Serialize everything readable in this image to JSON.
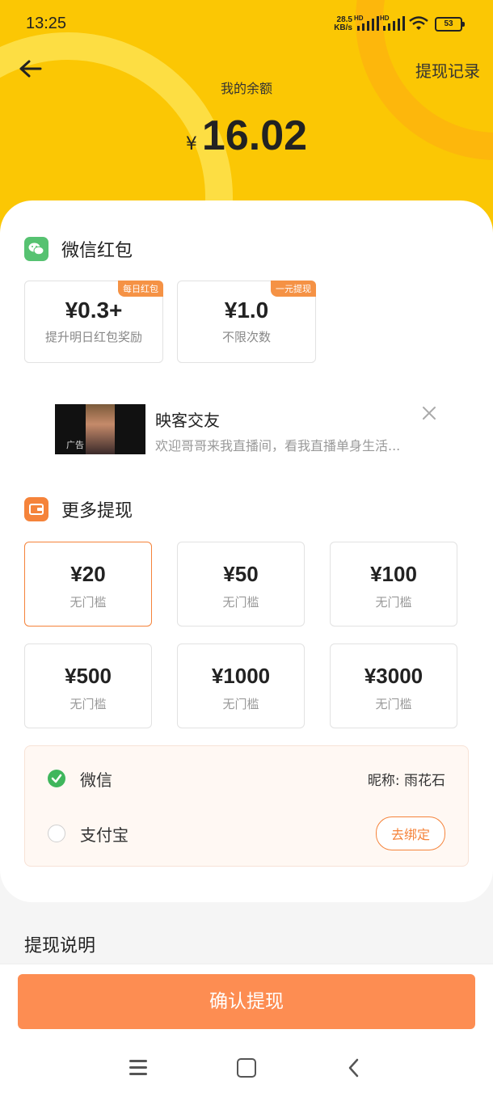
{
  "status_bar": {
    "time": "13:25",
    "net_speed_value": "28.5",
    "net_speed_unit": "KB/s",
    "hd1": "HD",
    "hd2": "HD",
    "battery": "53"
  },
  "header": {
    "history_link": "提现记录",
    "balance_label": "我的余额",
    "currency_symbol": "¥",
    "balance_value": "16.02",
    "bg_color": "#fbc704"
  },
  "wechat_section": {
    "title": "微信红包",
    "options": [
      {
        "amount": "¥0.3+",
        "desc": "提升明日红包奖励",
        "badge": "每日红包"
      },
      {
        "amount": "¥1.0",
        "desc": "不限次数",
        "badge": "一元提现"
      }
    ]
  },
  "ad": {
    "tag": "广告",
    "title": "映客交友",
    "desc": "欢迎哥哥来我直播间，看我直播单身生活..."
  },
  "more_section": {
    "title": "更多提现",
    "options": [
      {
        "amount": "¥20",
        "desc": "无门槛",
        "selected": true
      },
      {
        "amount": "¥50",
        "desc": "无门槛",
        "selected": false
      },
      {
        "amount": "¥100",
        "desc": "无门槛",
        "selected": false
      },
      {
        "amount": "¥500",
        "desc": "无门槛",
        "selected": false
      },
      {
        "amount": "¥1000",
        "desc": "无门槛",
        "selected": false
      },
      {
        "amount": "¥3000",
        "desc": "无门槛",
        "selected": false
      }
    ]
  },
  "payment": {
    "wechat_label": "微信",
    "wechat_nickname": "昵称: 雨花石",
    "alipay_label": "支付宝",
    "bind_button": "去绑定"
  },
  "explanation_title": "提现说明",
  "confirm_button": "确认提现",
  "colors": {
    "accent": "#f5833a",
    "confirm": "#fd8d52",
    "wechat_green": "#56c271",
    "checked_green": "#3fb65c"
  }
}
